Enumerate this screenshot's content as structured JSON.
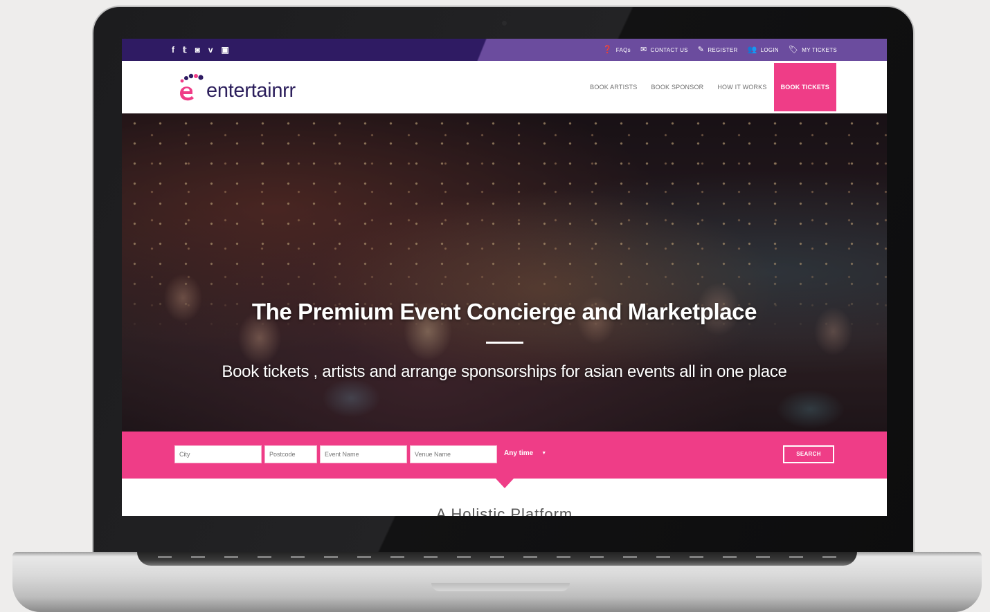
{
  "site": {
    "brand": "entertainrr",
    "brand_colors": {
      "primary_purple": "#2f1b63",
      "accent_pink": "#ef3d87"
    }
  },
  "topbar": {
    "social_icons": [
      "facebook-icon",
      "twitter-icon",
      "instagram-icon",
      "vimeo-icon",
      "youtube-icon"
    ],
    "links": [
      {
        "label": "FAQs",
        "icon": "question-circle-icon"
      },
      {
        "label": "CONTACT US",
        "icon": "envelope-icon"
      },
      {
        "label": "REGISTER",
        "icon": "edit-icon"
      },
      {
        "label": "LOGIN",
        "icon": "users-icon"
      },
      {
        "label": "MY TICKETS",
        "icon": "tag-icon"
      }
    ]
  },
  "nav": {
    "items": [
      {
        "label": "BOOK ARTISTS"
      },
      {
        "label": "BOOK SPONSOR"
      },
      {
        "label": "HOW IT WORKS"
      },
      {
        "label": "BOOK TICKETS",
        "active": true
      }
    ]
  },
  "hero": {
    "title": "The Premium Event Concierge and Marketplace",
    "subtitle": "Book tickets , artists and arrange sponsorships for asian events all in one place"
  },
  "search": {
    "city_placeholder": "City",
    "postcode_placeholder": "Postcode",
    "event_placeholder": "Event Name",
    "venue_placeholder": "Venue Name",
    "time_selected": "Any time",
    "button_label": "SEARCH"
  },
  "section": {
    "title": "A Holistic Platform"
  }
}
